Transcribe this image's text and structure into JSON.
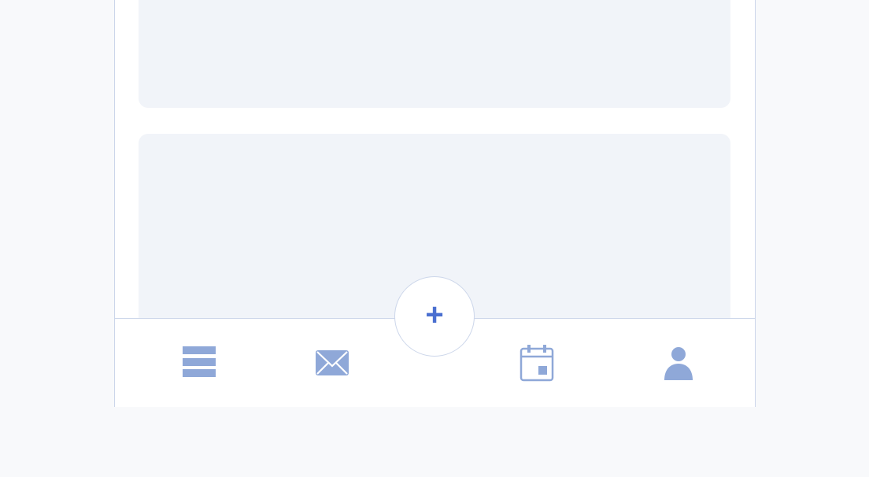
{
  "colors": {
    "background": "#f8f9fb",
    "panel": "#ffffff",
    "card": "#f1f4f9",
    "border": "#ccd6ea",
    "icon": "#8fa8d8",
    "accent": "#4a6fd0"
  },
  "tabbar": {
    "tabs": [
      {
        "icon": "menu-icon"
      },
      {
        "icon": "mail-icon"
      },
      {
        "icon": "calendar-icon"
      },
      {
        "icon": "profile-icon"
      }
    ],
    "fab": {
      "label": "+",
      "icon": "add-icon"
    }
  }
}
